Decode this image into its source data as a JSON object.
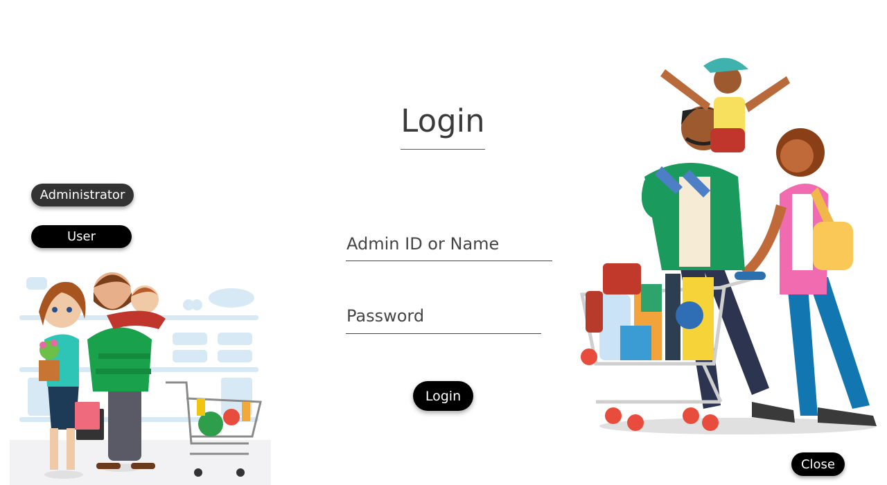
{
  "login": {
    "title": "Login",
    "admin_id_placeholder": "Admin ID or Name",
    "password_placeholder": "Password",
    "login_label": "Login"
  },
  "roles": {
    "administrator_label": "Administrator",
    "user_label": "User"
  },
  "window": {
    "close_label": "Close"
  },
  "illustrations": {
    "left": "family-shopping-illustration",
    "right": "family-cart-illustration"
  },
  "colors": {
    "button_dark": "#000000",
    "button_selected": "#333333",
    "text": "#3a3a3a"
  }
}
